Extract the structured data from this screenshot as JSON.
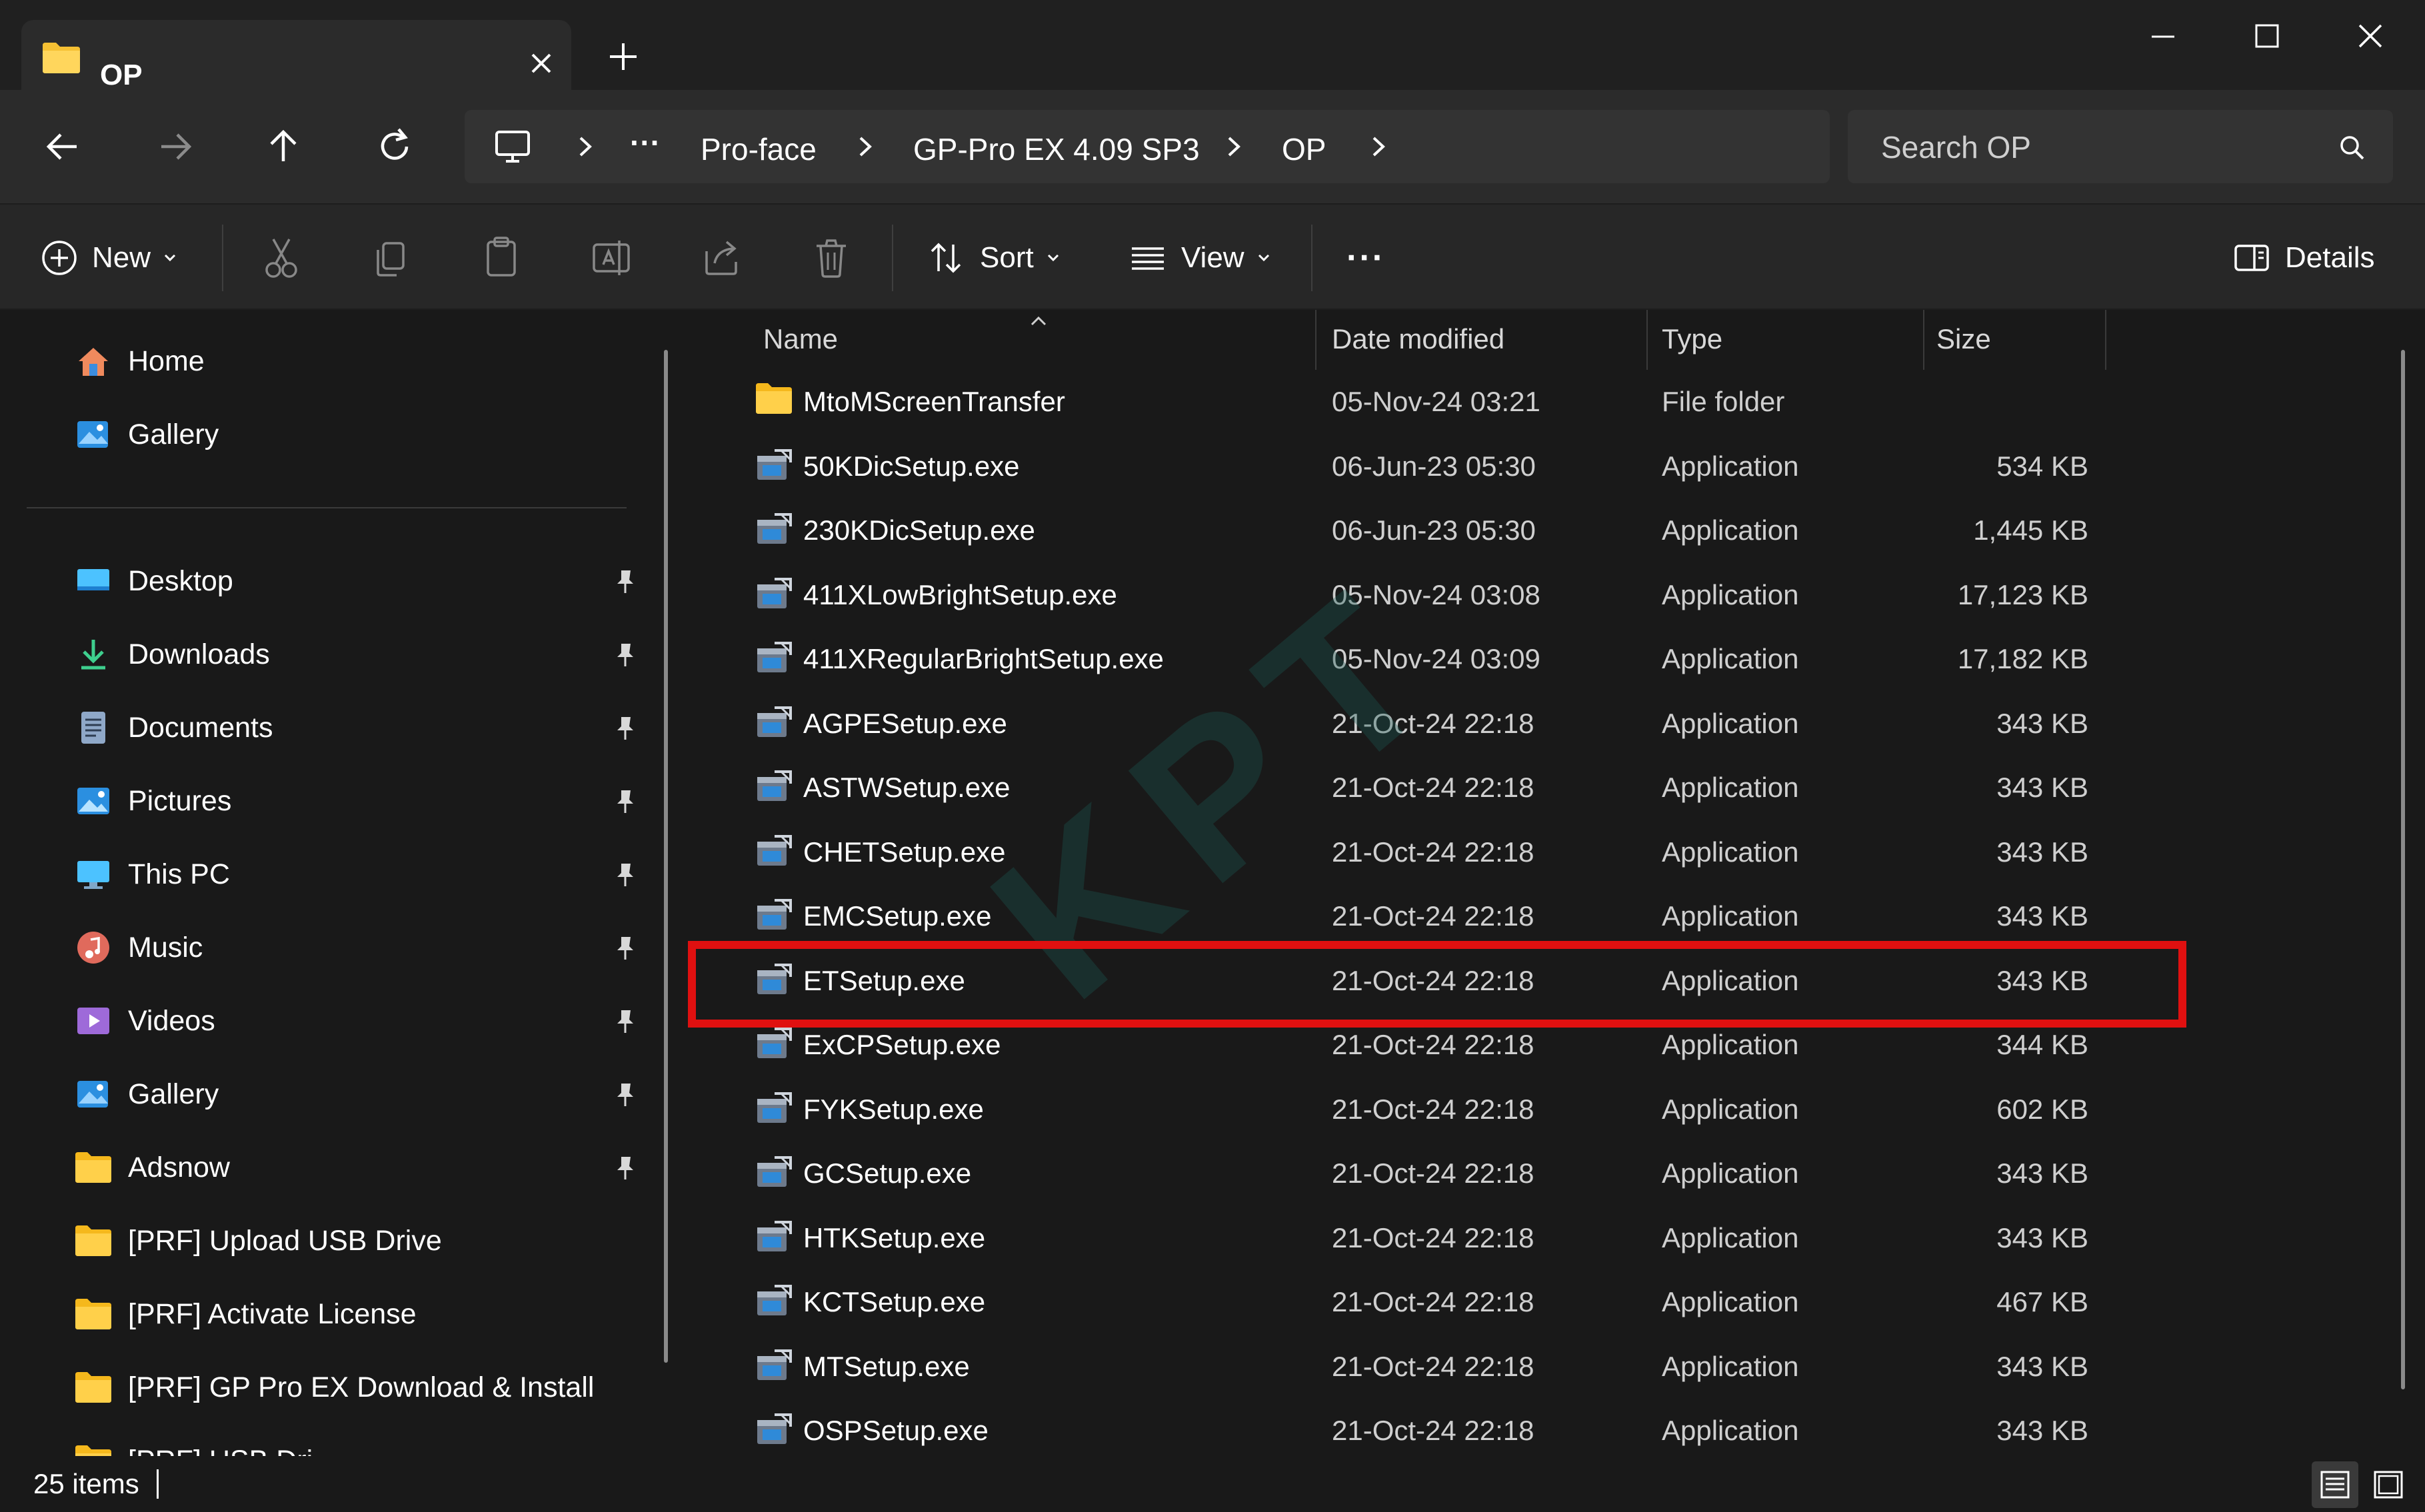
{
  "window": {
    "tab_title": "OP",
    "tab_icon": "folder-icon",
    "controls": [
      "minimize-icon",
      "maximize-icon",
      "close-icon"
    ]
  },
  "nav": {
    "breadcrumbs": [
      "Pro-face",
      "GP-Pro EX 4.09 SP3",
      "OP"
    ],
    "overflow": "···",
    "search_placeholder": "Search OP"
  },
  "toolbar": {
    "new_label": "New",
    "sort_label": "Sort",
    "view_label": "View",
    "more_label": "···",
    "details_label": "Details"
  },
  "sidebar": {
    "top": [
      {
        "label": "Home",
        "icon": "home-icon"
      },
      {
        "label": "Gallery",
        "icon": "gallery-icon"
      }
    ],
    "pinned": [
      {
        "label": "Desktop",
        "icon": "desktop-icon"
      },
      {
        "label": "Downloads",
        "icon": "download-icon"
      },
      {
        "label": "Documents",
        "icon": "document-icon"
      },
      {
        "label": "Pictures",
        "icon": "pictures-icon"
      },
      {
        "label": "This PC",
        "icon": "pc-icon"
      },
      {
        "label": "Music",
        "icon": "music-icon"
      },
      {
        "label": "Videos",
        "icon": "videos-icon"
      },
      {
        "label": "Gallery",
        "icon": "gallery-icon"
      },
      {
        "label": "Adsnow",
        "icon": "folder-icon"
      }
    ],
    "folders": [
      {
        "label": "[PRF] Upload USB Drive"
      },
      {
        "label": "[PRF] Activate License"
      },
      {
        "label": "[PRF] GP Pro EX Download & Install"
      },
      {
        "label": "[PRF] USB Dri..."
      }
    ]
  },
  "columns": [
    "Name",
    "Date modified",
    "Type",
    "Size"
  ],
  "files": [
    {
      "name": "MtoMScreenTransfer",
      "date": "05-Nov-24 03:21",
      "type": "File folder",
      "size": "",
      "kind": "folder"
    },
    {
      "name": "50KDicSetup.exe",
      "date": "06-Jun-23 05:30",
      "type": "Application",
      "size": "534 KB",
      "kind": "app"
    },
    {
      "name": "230KDicSetup.exe",
      "date": "06-Jun-23 05:30",
      "type": "Application",
      "size": "1,445 KB",
      "kind": "app"
    },
    {
      "name": "411XLowBrightSetup.exe",
      "date": "05-Nov-24 03:08",
      "type": "Application",
      "size": "17,123 KB",
      "kind": "app"
    },
    {
      "name": "411XRegularBrightSetup.exe",
      "date": "05-Nov-24 03:09",
      "type": "Application",
      "size": "17,182 KB",
      "kind": "app"
    },
    {
      "name": "AGPESetup.exe",
      "date": "21-Oct-24 22:18",
      "type": "Application",
      "size": "343 KB",
      "kind": "app"
    },
    {
      "name": "ASTWSetup.exe",
      "date": "21-Oct-24 22:18",
      "type": "Application",
      "size": "343 KB",
      "kind": "app"
    },
    {
      "name": "CHETSetup.exe",
      "date": "21-Oct-24 22:18",
      "type": "Application",
      "size": "343 KB",
      "kind": "app"
    },
    {
      "name": "EMCSetup.exe",
      "date": "21-Oct-24 22:18",
      "type": "Application",
      "size": "343 KB",
      "kind": "app"
    },
    {
      "name": "ETSetup.exe",
      "date": "21-Oct-24 22:18",
      "type": "Application",
      "size": "343 KB",
      "kind": "app",
      "highlighted": true
    },
    {
      "name": "ExCPSetup.exe",
      "date": "21-Oct-24 22:18",
      "type": "Application",
      "size": "344 KB",
      "kind": "app"
    },
    {
      "name": "FYKSetup.exe",
      "date": "21-Oct-24 22:18",
      "type": "Application",
      "size": "602 KB",
      "kind": "app"
    },
    {
      "name": "GCSetup.exe",
      "date": "21-Oct-24 22:18",
      "type": "Application",
      "size": "343 KB",
      "kind": "app"
    },
    {
      "name": "HTKSetup.exe",
      "date": "21-Oct-24 22:18",
      "type": "Application",
      "size": "343 KB",
      "kind": "app"
    },
    {
      "name": "KCTSetup.exe",
      "date": "21-Oct-24 22:18",
      "type": "Application",
      "size": "467 KB",
      "kind": "app"
    },
    {
      "name": "MTSetup.exe",
      "date": "21-Oct-24 22:18",
      "type": "Application",
      "size": "343 KB",
      "kind": "app"
    },
    {
      "name": "OSPSetup.exe",
      "date": "21-Oct-24 22:18",
      "type": "Application",
      "size": "343 KB",
      "kind": "app"
    }
  ],
  "status": {
    "item_count": "25 items"
  },
  "watermark": "KPT",
  "colors": {
    "highlight": "#e01010",
    "folder": "#f5c033",
    "accent": "#4cc2ff"
  }
}
